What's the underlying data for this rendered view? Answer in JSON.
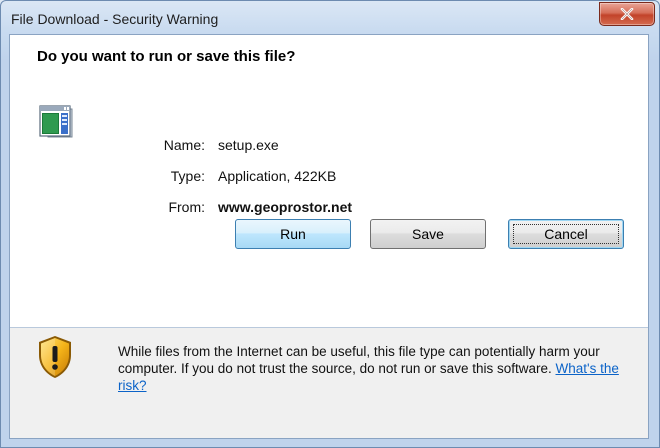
{
  "window": {
    "title": "File Download - Security Warning"
  },
  "dialog": {
    "heading": "Do you want to run or save this file?",
    "file_icon": "application-window-icon",
    "details": {
      "name_label": "Name:",
      "name_value": "setup.exe",
      "type_label": "Type:",
      "type_value": "Application, 422KB",
      "from_label": "From:",
      "from_value": "www.geoprostor.net"
    },
    "buttons": {
      "run": "Run",
      "save": "Save",
      "cancel": "Cancel"
    },
    "warning": {
      "icon": "shield-warning-icon",
      "text": "While files from the Internet can be useful, this file type can potentially harm your computer. If you do not trust the source, do not run or save this software.",
      "link": "What's the risk?"
    }
  },
  "colors": {
    "link": "#0b63c8",
    "close_button": "#c2432a",
    "title_bar": "#c9dbf0",
    "footer_background": "#f0f0f0"
  }
}
